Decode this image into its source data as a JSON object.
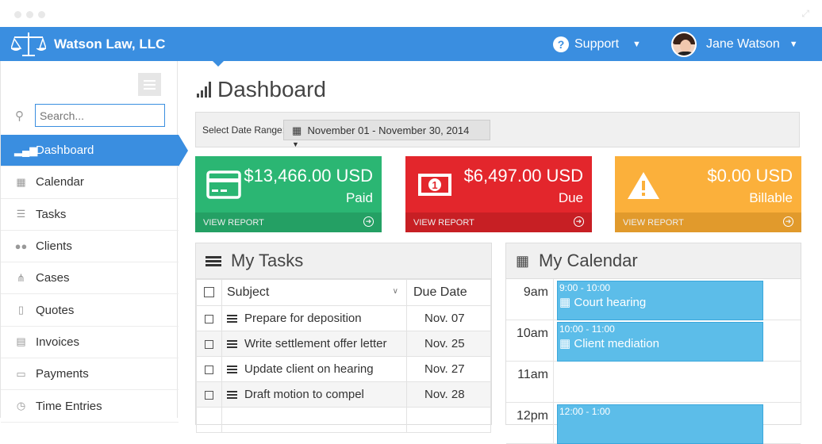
{
  "app": {
    "title": "Watson Law, LLC"
  },
  "header": {
    "support_label": "Support",
    "user_name": "Jane Watson"
  },
  "sidebar": {
    "search_placeholder": "Search...",
    "items": [
      {
        "label": "Dashboard",
        "icon": "bar-chart-icon",
        "glyph": "▂▄▆",
        "active": true
      },
      {
        "label": "Calendar",
        "icon": "calendar-icon",
        "glyph": "▦"
      },
      {
        "label": "Tasks",
        "icon": "list-icon",
        "glyph": "☰"
      },
      {
        "label": "Clients",
        "icon": "users-icon",
        "glyph": "●●"
      },
      {
        "label": "Cases",
        "icon": "sitemap-icon",
        "glyph": "⋔"
      },
      {
        "label": "Quotes",
        "icon": "document-icon",
        "glyph": "▯"
      },
      {
        "label": "Invoices",
        "icon": "invoice-icon",
        "glyph": "▤"
      },
      {
        "label": "Payments",
        "icon": "credit-card-icon",
        "glyph": "▭"
      },
      {
        "label": "Time Entries",
        "icon": "clock-icon",
        "glyph": "◷"
      }
    ]
  },
  "main": {
    "page_title": "Dashboard",
    "date_range_label": "Select Date Range:",
    "date_range_value": "November 01 - November 30, 2014",
    "cards": [
      {
        "amount": "$13,466.00 USD",
        "label": "Paid",
        "link": "VIEW REPORT",
        "color": "#2bb673",
        "foot_color": "#24a064"
      },
      {
        "amount": "$6,497.00 USD",
        "label": "Due",
        "link": "VIEW REPORT",
        "color": "#e3262c",
        "foot_color": "#c71f24"
      },
      {
        "amount": "$0.00 USD",
        "label": "Billable",
        "link": "VIEW REPORT",
        "color": "#fbb03b",
        "foot_color": "#e19a2c"
      }
    ]
  },
  "tasks": {
    "title": "My Tasks",
    "col_subject": "Subject",
    "col_due": "Due Date",
    "rows": [
      {
        "subject": "Prepare for deposition",
        "due": "Nov. 07"
      },
      {
        "subject": "Write settlement offer letter",
        "due": "Nov. 25"
      },
      {
        "subject": "Update client on hearing",
        "due": "Nov. 27"
      },
      {
        "subject": "Draft motion to compel",
        "due": "Nov. 28"
      }
    ]
  },
  "calendar": {
    "title": "My Calendar",
    "times": [
      "9am",
      "10am",
      "11am",
      "12pm"
    ],
    "events": [
      {
        "time": "9:00 - 10:00",
        "name": "Court hearing"
      },
      {
        "time": "10:00 - 11:00",
        "name": "Client mediation"
      },
      {
        "time": "12:00 - 1:00",
        "name": ""
      }
    ]
  }
}
